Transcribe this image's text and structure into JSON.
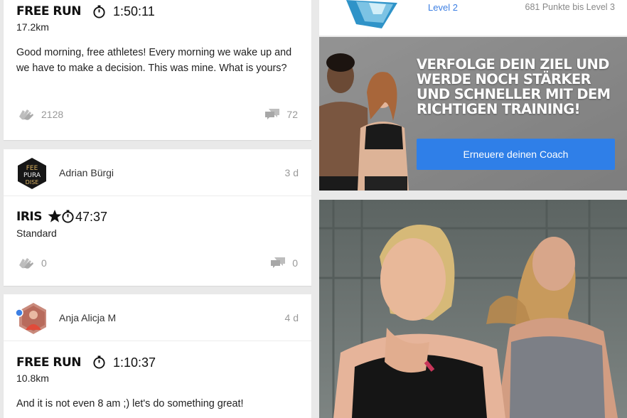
{
  "feed": {
    "card1": {
      "workout_name": "FREE RUN",
      "time": "1:50:11",
      "distance": "17.2km",
      "text": "Good morning, free athletes! Every morning we wake up and we have to make a decision. This was mine. What is yours?",
      "claps": "2128",
      "comments": "72"
    },
    "card2": {
      "author": "Adrian Bürgi",
      "age": "3 d",
      "workout_name": "IRIS",
      "time": "47:37",
      "variant": "Standard",
      "claps": "0",
      "comments": "0"
    },
    "card3": {
      "author": "Anja Alicja M",
      "age": "4 d",
      "workout_name": "FREE RUN",
      "time": "1:10:37",
      "distance": "10.8km",
      "text": "And it is not even 8 am ;) let's do something great!"
    }
  },
  "sidebar": {
    "level": "Level 2",
    "points": "681 Punkte bis Level 3",
    "promo_headline": "Verfolge dein Ziel und werde noch stärker und schneller mit dem richtigen Training!",
    "promo_button": "Erneuere deinen Coach"
  },
  "colors": {
    "accent": "#2f7fe8",
    "link": "#3c7fe3",
    "muted": "#999999"
  },
  "icons": {
    "clap": "clap-icon",
    "comment": "comment-icon",
    "clock": "stopwatch-icon",
    "star": "star-icon"
  }
}
